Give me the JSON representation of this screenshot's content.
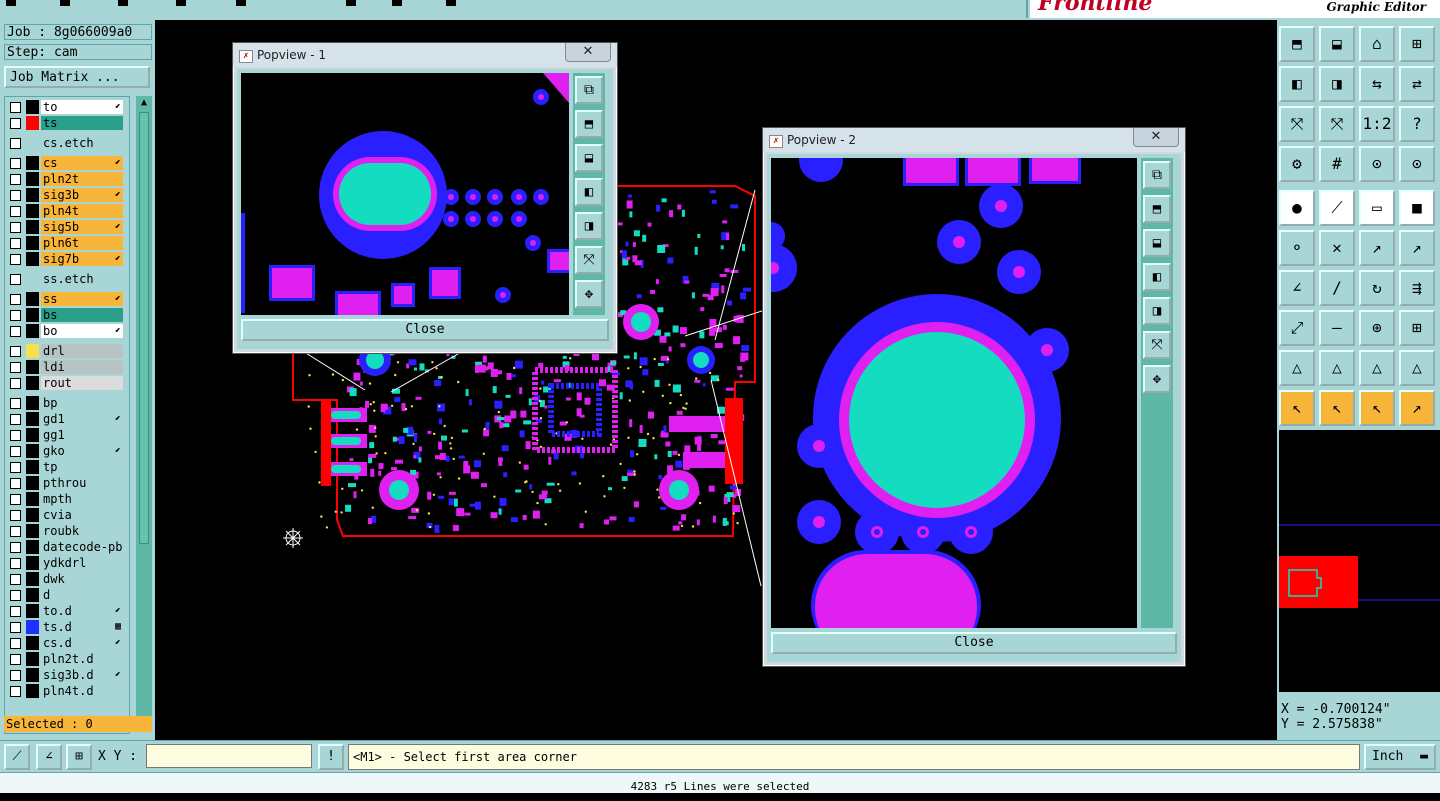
{
  "brand": {
    "logo": "Frontline",
    "subtitle": "Graphic Editor"
  },
  "job": {
    "job_line": "Job : 8g066009a0",
    "step_line": "Step: cam",
    "matrix_button": "Job Matrix ..."
  },
  "layers": [
    {
      "name": "to",
      "swatch": "#000000",
      "bg": "#ffffff",
      "mark": "⬋"
    },
    {
      "name": "ts",
      "swatch": "#ff0000",
      "bg": "#2aa08a",
      "mark": ""
    },
    {
      "name": "cs.etch",
      "swatch": "#a8d6d6",
      "bg": "#a8d6d6",
      "mark": ""
    },
    {
      "name": "cs",
      "swatch": "#000000",
      "bg": "#f7b53a",
      "mark": "⬋"
    },
    {
      "name": "pln2t",
      "swatch": "#000000",
      "bg": "#f7b53a",
      "mark": ""
    },
    {
      "name": "sig3b",
      "swatch": "#000000",
      "bg": "#f7b53a",
      "mark": "⬋"
    },
    {
      "name": "pln4t",
      "swatch": "#000000",
      "bg": "#f7b53a",
      "mark": ""
    },
    {
      "name": "sig5b",
      "swatch": "#000000",
      "bg": "#f7b53a",
      "mark": "⬋"
    },
    {
      "name": "pln6t",
      "swatch": "#000000",
      "bg": "#f7b53a",
      "mark": ""
    },
    {
      "name": "sig7b",
      "swatch": "#000000",
      "bg": "#f7b53a",
      "mark": "⬋"
    },
    {
      "name": "ss.etch",
      "swatch": "#a8d6d6",
      "bg": "#a8d6d6",
      "mark": ""
    },
    {
      "name": "ss",
      "swatch": "#000000",
      "bg": "#f7b53a",
      "mark": "⬋"
    },
    {
      "name": "bs",
      "swatch": "#000000",
      "bg": "#2aa08a",
      "mark": ""
    },
    {
      "name": "bo",
      "swatch": "#000000",
      "bg": "#ffffff",
      "mark": "⬋"
    },
    {
      "name": "drl",
      "swatch": "#f5e050",
      "bg": "#b8c4c4",
      "mark": ""
    },
    {
      "name": "ldi",
      "swatch": "#000000",
      "bg": "#b8c4c4",
      "mark": ""
    },
    {
      "name": "rout",
      "swatch": "#000000",
      "bg": "#dcdcdc",
      "mark": ""
    },
    {
      "name": "bp",
      "swatch": "#000000",
      "bg": "#a8d6d6",
      "mark": ""
    },
    {
      "name": "gd1",
      "swatch": "#000000",
      "bg": "#a8d6d6",
      "mark": "⬋"
    },
    {
      "name": "gg1",
      "swatch": "#000000",
      "bg": "#a8d6d6",
      "mark": ""
    },
    {
      "name": "gko",
      "swatch": "#000000",
      "bg": "#a8d6d6",
      "mark": "⬋"
    },
    {
      "name": "tp",
      "swatch": "#000000",
      "bg": "#a8d6d6",
      "mark": ""
    },
    {
      "name": "pthrou",
      "swatch": "#000000",
      "bg": "#a8d6d6",
      "mark": ""
    },
    {
      "name": "mpth",
      "swatch": "#000000",
      "bg": "#a8d6d6",
      "mark": ""
    },
    {
      "name": "cvia",
      "swatch": "#000000",
      "bg": "#a8d6d6",
      "mark": ""
    },
    {
      "name": "roubk",
      "swatch": "#000000",
      "bg": "#a8d6d6",
      "mark": ""
    },
    {
      "name": "datecode-pbc",
      "swatch": "#000000",
      "bg": "#a8d6d6",
      "mark": ""
    },
    {
      "name": "ydkdrl",
      "swatch": "#000000",
      "bg": "#a8d6d6",
      "mark": ""
    },
    {
      "name": "dwk",
      "swatch": "#000000",
      "bg": "#a8d6d6",
      "mark": ""
    },
    {
      "name": "d",
      "swatch": "#000000",
      "bg": "#a8d6d6",
      "mark": ""
    },
    {
      "name": "to.d",
      "swatch": "#000000",
      "bg": "#a8d6d6",
      "mark": "⬋"
    },
    {
      "name": "ts.d",
      "swatch": "#2030ff",
      "bg": "#a8d6d6",
      "mark": "▦"
    },
    {
      "name": "cs.d",
      "swatch": "#000000",
      "bg": "#a8d6d6",
      "mark": "⬋"
    },
    {
      "name": "pln2t.d",
      "swatch": "#000000",
      "bg": "#a8d6d6",
      "mark": ""
    },
    {
      "name": "sig3b.d",
      "swatch": "#000000",
      "bg": "#a8d6d6",
      "mark": "⬋"
    },
    {
      "name": "pln4t.d",
      "swatch": "#000000",
      "bg": "#a8d6d6",
      "mark": ""
    }
  ],
  "selected": "Selected : 0",
  "popview1": {
    "title": "Popview - 1",
    "close_x": "✕",
    "close_label": "Close"
  },
  "popview2": {
    "title": "Popview - 2",
    "close_x": "✕",
    "close_label": "Close"
  },
  "right_tools": [
    "⬒",
    "⬓",
    "⌂",
    "⊞",
    "◧",
    "◨",
    "⇆",
    "⇄",
    "⤧",
    "⤧",
    "1:2",
    "?",
    "⚙",
    "#",
    "⊙",
    "⊙",
    "●",
    "⟋",
    "▭",
    "■",
    "⚬",
    "✕",
    "↗",
    "↗",
    "∠",
    "/",
    "↻",
    "⇶",
    "⤢",
    "—",
    "⊕",
    "⊞",
    "△",
    "△",
    "△",
    "△",
    "↖",
    "↖",
    "↖",
    "↗"
  ],
  "coords": {
    "x": "X = -0.700124\"",
    "y": "Y = 2.575838\""
  },
  "bottom": {
    "xy_label": "X Y :",
    "xy_value": "",
    "bang": "!",
    "prompt": "<M1> - Select first area corner",
    "unit": "Inch"
  },
  "status": "4283 r5 Lines were selected",
  "colors": {
    "panel": "#a8d6d6",
    "teal": "#2aa08a",
    "orange": "#f7b53a",
    "pad_blue": "#2a20ff",
    "pad_magenta": "#e020f0",
    "pad_cyan": "#14dcc0",
    "board_red": "#ff0000"
  }
}
